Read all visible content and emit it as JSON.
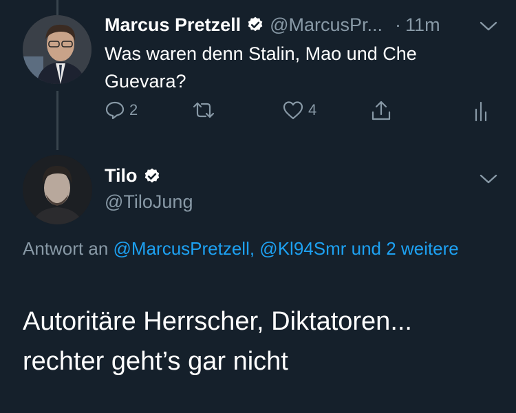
{
  "tweet1": {
    "author_name": "Marcus Pretzell",
    "author_handle": "@MarcusPr...",
    "separator": "·",
    "time": "11m",
    "text": "Was waren denn Stalin, Mao und Che Guevara?",
    "reply_count": "2",
    "like_count": "4"
  },
  "tweet2": {
    "author_name": "Tilo",
    "author_handle": "@TiloJung",
    "reply_prefix": "Antwort an",
    "reply_mentions": "@MarcusPretzell, @Kl94Smr und 2 weitere",
    "text_line1": "Autoritäre Herrscher, Diktatoren...",
    "text_line2": "rechter geht’s gar nicht"
  },
  "colors": {
    "background": "#15202b",
    "primary_text": "#ffffff",
    "secondary_text": "#8899a6",
    "link": "#1da1f2",
    "thread_line": "#38444d"
  },
  "icons": [
    "verified-badge-icon",
    "chevron-down-icon",
    "reply-icon",
    "retweet-icon",
    "like-icon",
    "share-icon",
    "analytics-icon"
  ]
}
